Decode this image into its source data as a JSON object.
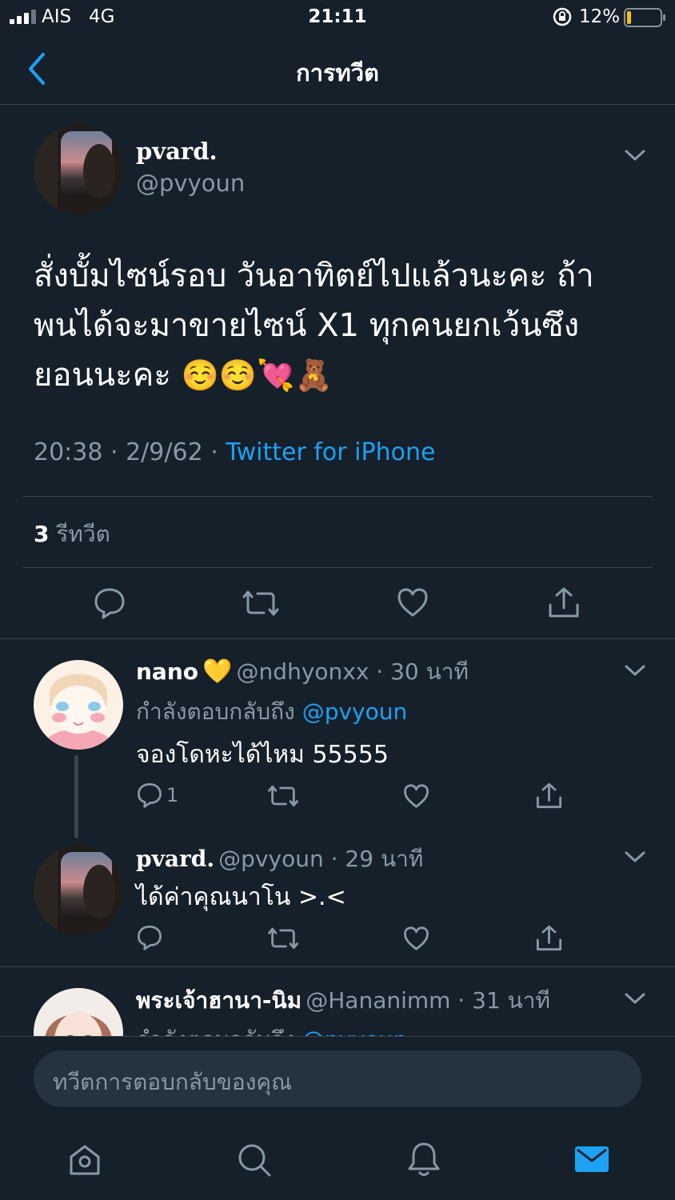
{
  "status_bar": {
    "carrier": "AIS   4G",
    "time": "21:11",
    "battery_percent": "12%",
    "battery_level": 0.12,
    "battery_color": "#f5c400"
  },
  "nav": {
    "title": "การทวีต",
    "back_icon": "chevron-left-icon"
  },
  "colors": {
    "background": "#15202b",
    "accent": "#1da1f2",
    "secondary_text": "#8899a6",
    "divider": "#38444d"
  },
  "main_tweet": {
    "display_name": "pvard.",
    "handle": "@pvyoun",
    "text_line1": "สั่งบั้มไซน์รอบ วันอาทิตย์ไปแล้วนะคะ ถ้า",
    "text_line2": "พนได้จะมาขายไซน์ X1 ทุกคนยกเว้นซึง",
    "text_line3": "ยอนนะคะ",
    "emoji": "☺️☺️💘🧸",
    "time": "20:38",
    "date": "2/9/62",
    "source": "Twitter for iPhone",
    "retweet_count": "3",
    "retweet_label": "รีทวีต"
  },
  "replies": [
    {
      "display_name": "nano",
      "name_emoji": "💛",
      "handle": "@ndhyonxx",
      "time_ago": "30 นาที",
      "replying_label": "กำลังตอบกลับถึง",
      "replying_to": "@pvyoun",
      "text": "จองโดหะได้ไหม 55555",
      "reply_count": "1"
    },
    {
      "display_name": "pvard.",
      "handle": "@pvyoun",
      "time_ago": "29 นาที",
      "text": "ได้ค่าคุณนาโน >.<"
    },
    {
      "display_name": "พระเจ้าฮานา-นิม",
      "handle": "@Hananimm",
      "time_ago": "31 นาที",
      "replying_label": "กำลังตอบกลับถึง",
      "replying_to": "@pvyoun"
    }
  ],
  "composer": {
    "placeholder": "ทวีตการตอบกลับของคุณ"
  },
  "tab_bar": {
    "items": [
      "home-icon",
      "search-icon",
      "notifications-icon",
      "messages-icon"
    ],
    "active": "messages-icon"
  }
}
